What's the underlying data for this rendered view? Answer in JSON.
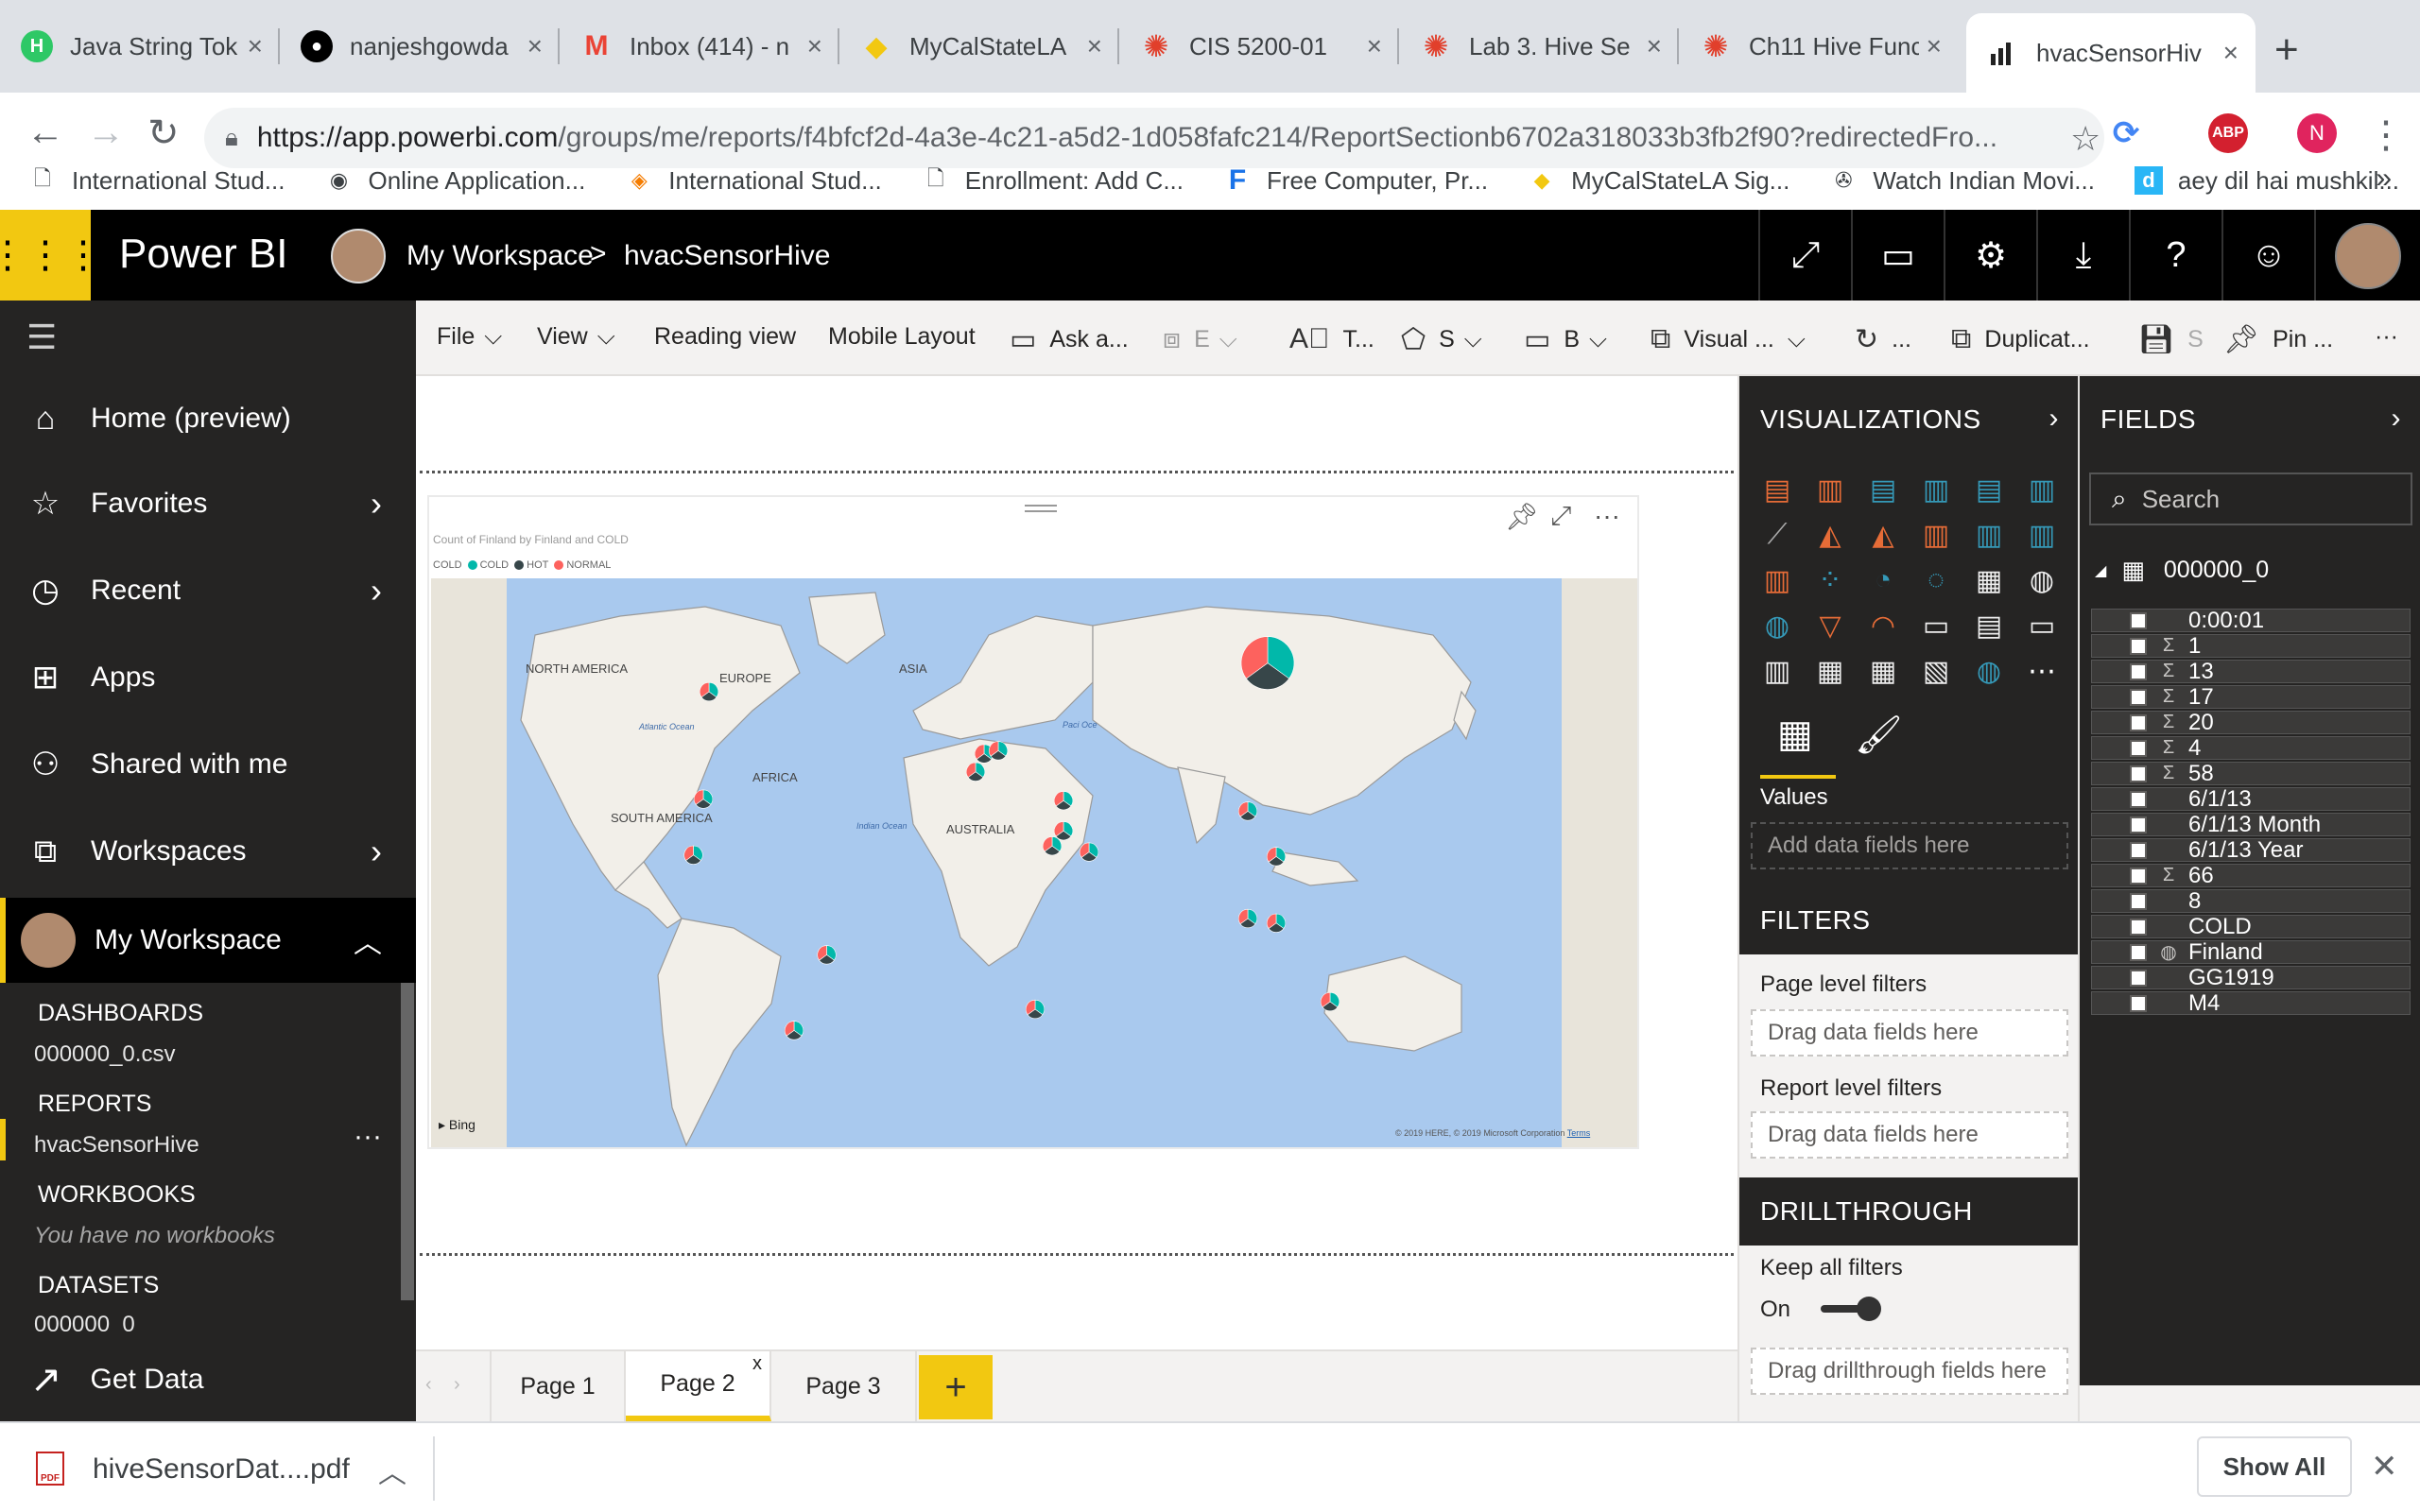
{
  "browser": {
    "tabs": [
      {
        "title": "Java String Tok",
        "favicon": "hackerrank-icon",
        "color": "#2ec866",
        "glyph": "H"
      },
      {
        "title": "nanjeshgowda",
        "favicon": "github-icon",
        "color": "#000000",
        "glyph": "●"
      },
      {
        "title": "Inbox (414) - n",
        "favicon": "gmail-icon",
        "color": "#ea4335",
        "glyph": "M"
      },
      {
        "title": "MyCalStateLA",
        "favicon": "shield-icon",
        "color": "#f2c811",
        "glyph": "◆"
      },
      {
        "title": "CIS 5200-01",
        "favicon": "canvas-icon",
        "color": "#e13f2b",
        "glyph": "✺"
      },
      {
        "title": "Lab 3. Hive Se",
        "favicon": "canvas-icon",
        "color": "#e13f2b",
        "glyph": "✺"
      },
      {
        "title": "Ch11 Hive Func",
        "favicon": "canvas-icon",
        "color": "#e13f2b",
        "glyph": "✺"
      },
      {
        "title": "hvacSensorHiv",
        "favicon": "powerbi-icon",
        "color": "#000000",
        "glyph": "▮"
      }
    ],
    "url_host": "https://app.powerbi.com",
    "url_rest": "/groups/me/reports/f4bfcf2d-4a3e-4c21-a5d2-1d058fafc214/ReportSectionb6702a318033b3fb2f90?redirectedFro...",
    "extensions": [
      {
        "name": "sync-extension-icon",
        "label": "",
        "color": "#4285f4"
      },
      {
        "name": "adblock-icon",
        "label": "ABP",
        "color": "#d3202f"
      },
      {
        "name": "profile-icon",
        "label": "N",
        "color": "#e0245e"
      }
    ],
    "bookmarks": [
      {
        "label": "International Stud...",
        "icon": "page-icon",
        "glyph": "🗋"
      },
      {
        "label": "Online Application...",
        "icon": "globe-icon",
        "glyph": "◉"
      },
      {
        "label": "International Stud...",
        "icon": "diamond-icon",
        "glyph": "◈"
      },
      {
        "label": "Enrollment: Add C...",
        "icon": "page-icon",
        "glyph": "🗋"
      },
      {
        "label": "Free Computer, Pr...",
        "icon": "f-icon",
        "glyph": "F"
      },
      {
        "label": "MyCalStateLA Sig...",
        "icon": "shield-icon",
        "glyph": "◆"
      },
      {
        "label": "Watch Indian Movi...",
        "icon": "film-icon",
        "glyph": "✇"
      },
      {
        "label": "aey dil hai mushkil...",
        "icon": "d-icon",
        "glyph": "d"
      }
    ]
  },
  "pbi": {
    "app_name": "Power BI",
    "workspace": "My Workspace",
    "crumb_sep": ">",
    "report": "hvacSensorHive"
  },
  "nav": {
    "items": [
      {
        "label": "Home (preview)",
        "icon": "home-icon",
        "glyph": "⌂"
      },
      {
        "label": "Favorites",
        "icon": "star-icon",
        "glyph": "☆"
      },
      {
        "label": "Recent",
        "icon": "clock-icon",
        "glyph": "◷"
      },
      {
        "label": "Apps",
        "icon": "apps-icon",
        "glyph": "⊞"
      },
      {
        "label": "Shared with me",
        "icon": "person-icon",
        "glyph": "⚇"
      },
      {
        "label": "Workspaces",
        "icon": "workspaces-icon",
        "glyph": "⧉"
      }
    ],
    "my_workspace": "My Workspace",
    "dashboards_label": "DASHBOARDS",
    "dashboard_item": "000000_0.csv",
    "reports_label": "REPORTS",
    "report_item": "hvacSensorHive",
    "report_more": "···",
    "workbooks_label": "WORKBOOKS",
    "workbooks_empty": "You have no workbooks",
    "datasets_label": "DATASETS",
    "dataset_item": "000000_0",
    "get_data": "Get Data"
  },
  "ribbon": {
    "file": "File",
    "view": "View",
    "reading_view": "Reading view",
    "mobile_layout": "Mobile Layout",
    "ask": "Ask a...",
    "explore": "E",
    "textbox": "T...",
    "shapes": "S",
    "buttons": "B",
    "visual_interactions": "Visual ...",
    "refresh": "...",
    "duplicate": "Duplicat...",
    "save": "S",
    "pin": "Pin ...",
    "more": "···"
  },
  "visual": {
    "title": "Count of Finland by Finland and COLD",
    "legend_title": "COLD",
    "legend": [
      {
        "label": "COLD",
        "color": "#01b8aa"
      },
      {
        "label": "HOT",
        "color": "#374649"
      },
      {
        "label": "NORMAL",
        "color": "#fd625e"
      }
    ],
    "map_labels": {
      "north_america": "NORTH AMERICA",
      "south_america": "SOUTH AMERICA",
      "europe": "EUROPE",
      "asia": "ASIA",
      "africa": "AFRICA",
      "australia": "AUSTRALIA",
      "atlantic": "Atlantic Ocean",
      "indian": "Indian Ocean",
      "pacific": "Paci Oce"
    },
    "bing": "Bing",
    "copyright": "© 2019 HERE, © 2019 Microsoft Corporation",
    "terms": "Terms",
    "colors": {
      "ocean": "#a9c9ee",
      "land": "#f2efe9",
      "border": "#9a9a9a"
    }
  },
  "pages": {
    "tabs": [
      "Page 1",
      "Page 2",
      "Page 3"
    ],
    "active": "Page 2",
    "close": "x",
    "add": "+"
  },
  "visualizations": {
    "header": "VISUALIZATIONS",
    "values_label": "Values",
    "values_drop": "Add data fields here",
    "filters_header": "FILTERS",
    "page_filters": "Page level filters",
    "page_drop": "Drag data fields here",
    "report_filters": "Report level filters",
    "report_drop": "Drag data fields here",
    "drill_header": "DRILLTHROUGH",
    "keep_filters": "Keep all filters",
    "toggle_state": "On",
    "drill_drop": "Drag drillthrough fields here",
    "icons": [
      "stacked-bar",
      "stacked-column",
      "clustered-bar",
      "clustered-column",
      "100-bar",
      "100-column",
      "line",
      "area",
      "stacked-area",
      "line-column",
      "line-clustered",
      "ribbon",
      "waterfall",
      "scatter",
      "pie",
      "donut",
      "treemap",
      "map",
      "filled-map",
      "funnel",
      "gauge",
      "card",
      "multirow-card",
      "kpi",
      "slicer",
      "table",
      "matrix",
      "r-visual",
      "arcgis",
      "more"
    ]
  },
  "fields": {
    "header": "FIELDS",
    "search_placeholder": "Search",
    "table": "000000_0",
    "items": [
      {
        "label": "0:00:01",
        "sigma": false
      },
      {
        "label": "1",
        "sigma": true
      },
      {
        "label": "13",
        "sigma": true
      },
      {
        "label": "17",
        "sigma": true
      },
      {
        "label": "20",
        "sigma": true
      },
      {
        "label": "4",
        "sigma": true
      },
      {
        "label": "58",
        "sigma": true
      },
      {
        "label": "6/1/13",
        "sigma": false
      },
      {
        "label": "6/1/13 Month",
        "sigma": false
      },
      {
        "label": "6/1/13 Year",
        "sigma": false
      },
      {
        "label": "66",
        "sigma": true
      },
      {
        "label": "8",
        "sigma": false
      },
      {
        "label": "COLD",
        "sigma": false
      },
      {
        "label": "Finland",
        "sigma": false,
        "globe": true
      },
      {
        "label": "GG1919",
        "sigma": false
      },
      {
        "label": "M4",
        "sigma": false
      }
    ]
  },
  "downloads": {
    "file": "hiveSensorDat....pdf",
    "show_all": "Show All"
  }
}
